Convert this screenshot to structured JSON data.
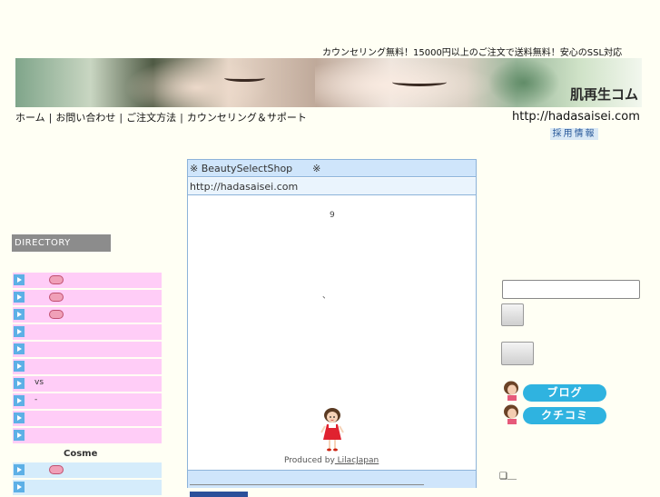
{
  "header": {
    "tagline": "カウンセリング無料！15000円以上のご注文で送料無料！安心のSSL対応",
    "brand": "肌再生コム",
    "url": "http://hadasaisei.com",
    "recruit": "採用情報"
  },
  "nav": [
    {
      "label": "ホーム"
    },
    {
      "label": "お問い合わせ"
    },
    {
      "label": "ご注文方法"
    },
    {
      "label": "カウンセリング＆サポート"
    }
  ],
  "sidebar": {
    "heading": "DIRECTORY",
    "items": [
      {
        "text": "",
        "badge": true,
        "color": "pink"
      },
      {
        "text": "",
        "badge": true,
        "color": "pink"
      },
      {
        "text": "",
        "badge": true,
        "color": "pink"
      },
      {
        "text": "",
        "badge": false,
        "color": "pink"
      },
      {
        "text": "",
        "badge": false,
        "color": "pink"
      },
      {
        "text": "",
        "badge": false,
        "color": "pink"
      },
      {
        "text": "vs",
        "badge": false,
        "color": "pink"
      },
      {
        "text": "-",
        "badge": false,
        "color": "pink"
      },
      {
        "text": "",
        "badge": false,
        "color": "pink"
      },
      {
        "text": "",
        "badge": false,
        "color": "pink"
      }
    ],
    "cosme_label": "Cosme",
    "cosme_items": [
      {
        "text": "",
        "badge": true,
        "color": "blue"
      },
      {
        "text": "",
        "badge": false,
        "color": "blue"
      }
    ]
  },
  "center": {
    "shop_title": "※ BeautySelectShop　　※",
    "shop_url": "http://hadasaisei.com",
    "number": "9",
    "dot": "、",
    "produced_prefix": "Produced by",
    "produced_link": " LilacJapan"
  },
  "right": {
    "blog_label": "ブログ",
    "kuchikomi_label": "クチコミ",
    "check_text": "❑＿"
  },
  "colors": {
    "pink_row": "#ffcdf7",
    "blue_row": "#d5ecfb",
    "accent": "#2fb3e0",
    "box_border": "#8db3d9"
  }
}
